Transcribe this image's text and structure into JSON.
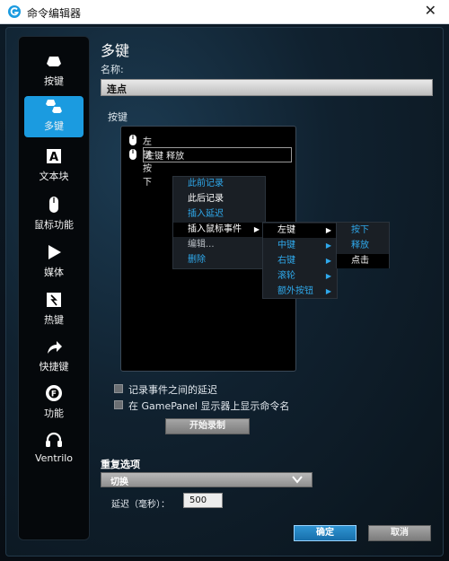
{
  "window": {
    "title": "命令编辑器",
    "close_glyph": "✕"
  },
  "colors": {
    "accent": "#1b9be0",
    "menu_blue": "#2fa9ec",
    "panel": "#10212f"
  },
  "sidebar": {
    "items": [
      {
        "label": "按键",
        "icon": "key-icon"
      },
      {
        "label": "多键",
        "icon": "multi-key-icon",
        "active": true
      },
      {
        "label": "文本块",
        "icon": "text-block-icon"
      },
      {
        "label": "鼠标功能",
        "icon": "mouse-icon"
      },
      {
        "label": "媒体",
        "icon": "play-icon"
      },
      {
        "label": "热键",
        "icon": "hotkey-icon"
      },
      {
        "label": "快捷键",
        "icon": "shortcut-arrow-icon"
      },
      {
        "label": "功能",
        "icon": "function-gear-icon"
      },
      {
        "label": "Ventrilo",
        "icon": "headset-icon"
      }
    ]
  },
  "main": {
    "heading": "多键",
    "name_label": "名称:",
    "name_value": "连点",
    "keys_label": "按键",
    "events": [
      {
        "text": "左键 按下"
      },
      {
        "text": "左键 释放",
        "selected": true
      }
    ]
  },
  "context_menu": {
    "items": [
      {
        "label": "此前记录"
      },
      {
        "label": "此后记录"
      },
      {
        "label": "插入延迟"
      },
      {
        "label": "插入鼠标事件",
        "has_submenu": true
      },
      {
        "label": "编辑..."
      },
      {
        "label": "删除"
      }
    ],
    "mouse_submenu": [
      {
        "label": "左键"
      },
      {
        "label": "中键"
      },
      {
        "label": "右键"
      },
      {
        "label": "滚轮"
      },
      {
        "label": "额外按钮"
      }
    ],
    "left_submenu": [
      {
        "label": "按下"
      },
      {
        "label": "释放"
      },
      {
        "label": "点击"
      }
    ]
  },
  "options": {
    "record_delay_label": "记录事件之间的延迟",
    "show_name_label": "在 GamePanel 显示器上显示命令名",
    "record_button": "开始录制"
  },
  "repeat": {
    "label": "重复选项",
    "selected": "切换",
    "delay_label": "延迟（毫秒）：",
    "delay_value": "500"
  },
  "footer": {
    "ok": "确定",
    "cancel": "取消"
  }
}
